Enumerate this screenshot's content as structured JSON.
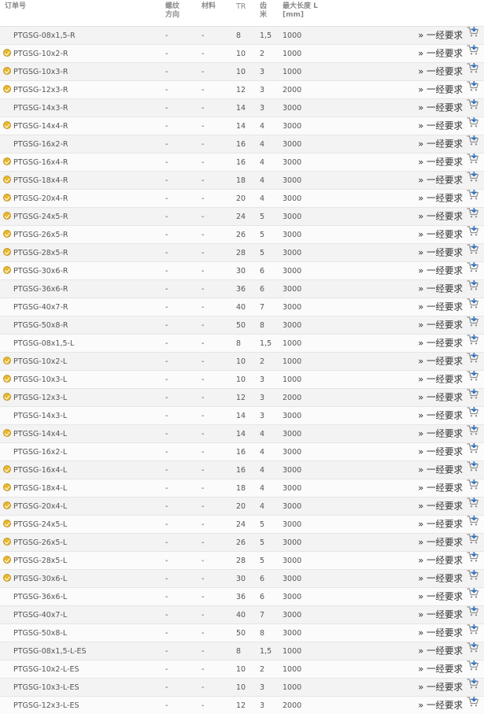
{
  "columns": {
    "order_no": "订单号",
    "thread_direction_1": "螺纹",
    "thread_direction_2": "方向",
    "material": "材料",
    "tr": "TR",
    "pitch_1": "齿",
    "pitch_2": "米",
    "max_length_1": "最大长度 L",
    "max_length_2": "[mm]"
  },
  "action": {
    "request_label": "» 一经要求",
    "cart_icon": "cart-add-icon"
  },
  "colors": {
    "stock_badge": "#e7b82a",
    "row_alt": "#f3f3f3",
    "cart_blue": "#2a72c2"
  },
  "rows": [
    {
      "order_no": "PTGSG-08x1,5-R",
      "stock": false,
      "direction": "-",
      "material": "-",
      "tr": "8",
      "pitch": "1,5",
      "length": "1000"
    },
    {
      "order_no": "PTGSG-10x2-R",
      "stock": true,
      "direction": "-",
      "material": "-",
      "tr": "10",
      "pitch": "2",
      "length": "1000"
    },
    {
      "order_no": "PTGSG-10x3-R",
      "stock": true,
      "direction": "-",
      "material": "-",
      "tr": "10",
      "pitch": "3",
      "length": "1000"
    },
    {
      "order_no": "PTGSG-12x3-R",
      "stock": true,
      "direction": "-",
      "material": "-",
      "tr": "12",
      "pitch": "3",
      "length": "2000"
    },
    {
      "order_no": "PTGSG-14x3-R",
      "stock": false,
      "direction": "-",
      "material": "-",
      "tr": "14",
      "pitch": "3",
      "length": "3000"
    },
    {
      "order_no": "PTGSG-14x4-R",
      "stock": true,
      "direction": "-",
      "material": "-",
      "tr": "14",
      "pitch": "4",
      "length": "3000"
    },
    {
      "order_no": "PTGSG-16x2-R",
      "stock": false,
      "direction": "-",
      "material": "-",
      "tr": "16",
      "pitch": "4",
      "length": "3000"
    },
    {
      "order_no": "PTGSG-16x4-R",
      "stock": true,
      "direction": "-",
      "material": "-",
      "tr": "16",
      "pitch": "4",
      "length": "3000"
    },
    {
      "order_no": "PTGSG-18x4-R",
      "stock": true,
      "direction": "-",
      "material": "-",
      "tr": "18",
      "pitch": "4",
      "length": "3000"
    },
    {
      "order_no": "PTGSG-20x4-R",
      "stock": true,
      "direction": "-",
      "material": "-",
      "tr": "20",
      "pitch": "4",
      "length": "3000"
    },
    {
      "order_no": "PTGSG-24x5-R",
      "stock": true,
      "direction": "-",
      "material": "-",
      "tr": "24",
      "pitch": "5",
      "length": "3000"
    },
    {
      "order_no": "PTGSG-26x5-R",
      "stock": true,
      "direction": "-",
      "material": "-",
      "tr": "26",
      "pitch": "5",
      "length": "3000"
    },
    {
      "order_no": "PTGSG-28x5-R",
      "stock": true,
      "direction": "-",
      "material": "-",
      "tr": "28",
      "pitch": "5",
      "length": "3000"
    },
    {
      "order_no": "PTGSG-30x6-R",
      "stock": true,
      "direction": "-",
      "material": "-",
      "tr": "30",
      "pitch": "6",
      "length": "3000"
    },
    {
      "order_no": "PTGSG-36x6-R",
      "stock": false,
      "direction": "-",
      "material": "-",
      "tr": "36",
      "pitch": "6",
      "length": "3000"
    },
    {
      "order_no": "PTGSG-40x7-R",
      "stock": false,
      "direction": "-",
      "material": "-",
      "tr": "40",
      "pitch": "7",
      "length": "3000"
    },
    {
      "order_no": "PTGSG-50x8-R",
      "stock": false,
      "direction": "-",
      "material": "-",
      "tr": "50",
      "pitch": "8",
      "length": "3000"
    },
    {
      "order_no": "PTGSG-08x1,5-L",
      "stock": false,
      "direction": "-",
      "material": "-",
      "tr": "8",
      "pitch": "1,5",
      "length": "1000"
    },
    {
      "order_no": "PTGSG-10x2-L",
      "stock": true,
      "direction": "-",
      "material": "-",
      "tr": "10",
      "pitch": "2",
      "length": "1000"
    },
    {
      "order_no": "PTGSG-10x3-L",
      "stock": true,
      "direction": "-",
      "material": "-",
      "tr": "10",
      "pitch": "3",
      "length": "1000"
    },
    {
      "order_no": "PTGSG-12x3-L",
      "stock": true,
      "direction": "-",
      "material": "-",
      "tr": "12",
      "pitch": "3",
      "length": "2000"
    },
    {
      "order_no": "PTGSG-14x3-L",
      "stock": false,
      "direction": "-",
      "material": "-",
      "tr": "14",
      "pitch": "3",
      "length": "3000"
    },
    {
      "order_no": "PTGSG-14x4-L",
      "stock": true,
      "direction": "-",
      "material": "-",
      "tr": "14",
      "pitch": "4",
      "length": "3000"
    },
    {
      "order_no": "PTGSG-16x2-L",
      "stock": false,
      "direction": "-",
      "material": "-",
      "tr": "16",
      "pitch": "4",
      "length": "3000"
    },
    {
      "order_no": "PTGSG-16x4-L",
      "stock": true,
      "direction": "-",
      "material": "-",
      "tr": "16",
      "pitch": "4",
      "length": "3000"
    },
    {
      "order_no": "PTGSG-18x4-L",
      "stock": true,
      "direction": "-",
      "material": "-",
      "tr": "18",
      "pitch": "4",
      "length": "3000"
    },
    {
      "order_no": "PTGSG-20x4-L",
      "stock": true,
      "direction": "-",
      "material": "-",
      "tr": "20",
      "pitch": "4",
      "length": "3000"
    },
    {
      "order_no": "PTGSG-24x5-L",
      "stock": true,
      "direction": "-",
      "material": "-",
      "tr": "24",
      "pitch": "5",
      "length": "3000"
    },
    {
      "order_no": "PTGSG-26x5-L",
      "stock": true,
      "direction": "-",
      "material": "-",
      "tr": "26",
      "pitch": "5",
      "length": "3000"
    },
    {
      "order_no": "PTGSG-28x5-L",
      "stock": true,
      "direction": "-",
      "material": "-",
      "tr": "28",
      "pitch": "5",
      "length": "3000"
    },
    {
      "order_no": "PTGSG-30x6-L",
      "stock": true,
      "direction": "-",
      "material": "-",
      "tr": "30",
      "pitch": "6",
      "length": "3000"
    },
    {
      "order_no": "PTGSG-36x6-L",
      "stock": false,
      "direction": "-",
      "material": "-",
      "tr": "36",
      "pitch": "6",
      "length": "3000"
    },
    {
      "order_no": "PTGSG-40x7-L",
      "stock": false,
      "direction": "-",
      "material": "-",
      "tr": "40",
      "pitch": "7",
      "length": "3000"
    },
    {
      "order_no": "PTGSG-50x8-L",
      "stock": false,
      "direction": "-",
      "material": "-",
      "tr": "50",
      "pitch": "8",
      "length": "3000"
    },
    {
      "order_no": "PTGSG-08x1,5-L-ES",
      "stock": false,
      "direction": "-",
      "material": "-",
      "tr": "8",
      "pitch": "1,5",
      "length": "1000"
    },
    {
      "order_no": "PTGSG-10x2-L-ES",
      "stock": false,
      "direction": "-",
      "material": "-",
      "tr": "10",
      "pitch": "2",
      "length": "1000"
    },
    {
      "order_no": "PTGSG-10x3-L-ES",
      "stock": false,
      "direction": "-",
      "material": "-",
      "tr": "10",
      "pitch": "3",
      "length": "1000"
    },
    {
      "order_no": "PTGSG-12x3-L-ES",
      "stock": false,
      "direction": "-",
      "material": "-",
      "tr": "12",
      "pitch": "3",
      "length": "2000"
    }
  ]
}
